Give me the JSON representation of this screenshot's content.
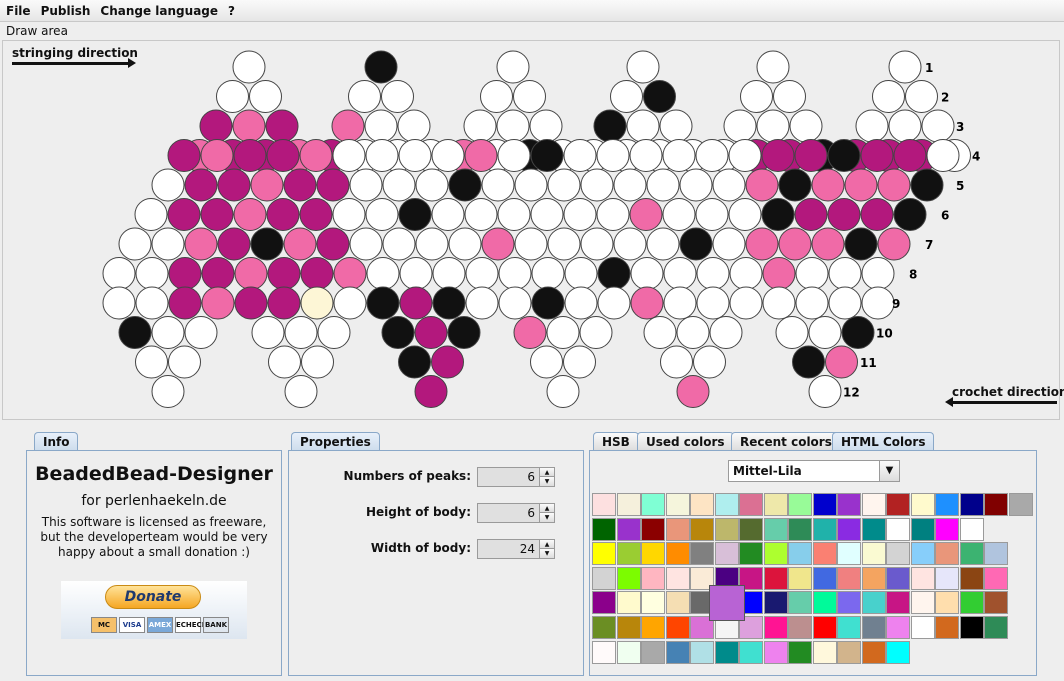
{
  "menu": [
    "File",
    "Publish",
    "Change language",
    "?"
  ],
  "draw_area": {
    "label": "Draw area",
    "stringing_direction": "stringing direction",
    "crochet_direction": "crochet direction",
    "row_numbers": [
      "1",
      "2",
      "3",
      "4",
      "5",
      "6",
      "7",
      "8",
      "9",
      "10",
      "11",
      "12"
    ]
  },
  "info": {
    "tab": "Info",
    "title": "BeadedBead-Designer",
    "subtitle": "for perlenhaekeln.de",
    "text": "This software is licensed as freeware, but the developerteam would be very happy about a small donation :)",
    "donate": "Donate",
    "cards": [
      "MC",
      "VISA",
      "AMEX",
      "ECHECK",
      "BANK"
    ]
  },
  "properties": {
    "tab": "Properties",
    "fields": [
      {
        "label": "Numbers of peaks:",
        "value": "6"
      },
      {
        "label": "Height of body:",
        "value": "6"
      },
      {
        "label": "Width of body:",
        "value": "24"
      }
    ]
  },
  "colors": {
    "tabs": [
      "HSB",
      "Used colors",
      "Recent colors",
      "HTML Colors"
    ],
    "active_tab": "HTML Colors",
    "selected": "Mittel-Lila",
    "selected_color": "#b863d4",
    "swatches": [
      [
        "#fde0e0",
        "#f5f0dc",
        "#7fffd4",
        "#f5f5dc",
        "#fde4c4",
        "#afeeee",
        "#db7093",
        "#eee8aa",
        "#98fb98",
        "#0000cd",
        "#9932cc",
        "#fff5ee",
        "#b22222",
        "#fffacd",
        "#1e90ff",
        "#00008b",
        "#800000",
        "#a9a9a9"
      ],
      [
        "#006400",
        "#9932cc",
        "#8b0000",
        "#e9967a",
        "#b8860b",
        "#bdb76b",
        "#556b2f",
        "#66cdaa",
        "#2e8b57",
        "#20b2aa",
        "#8a2be2",
        "#008b8b",
        "#ffffff",
        "#008080",
        "#ff00ff",
        "#ffffff"
      ],
      [
        "#ffff00",
        "#9acd32",
        "#ffd700",
        "#ff8c00",
        "#808080",
        "#d8bfd8",
        "#228b22",
        "#adff2f",
        "#87ceeb",
        "#fa8072",
        "#e0ffff",
        "#fafad2",
        "#d3d3d3",
        "#87cefa",
        "#e9967a",
        "#3cb371",
        "#b0c4de"
      ],
      [
        "#d3d3d3",
        "#7cfc00",
        "#ffb6c1",
        "#ffe4e1",
        "#faebd7",
        "#4b0082",
        "#c71585",
        "#dc143c",
        "#f0e68c",
        "#4169e1",
        "#f08080",
        "#f4a460",
        "#6a5acd",
        "#ffe4e1",
        "#e6e6fa",
        "#8b4513",
        "#ff69b4"
      ],
      [
        "#8b008b",
        "#fffacd",
        "#ffffe0",
        "#f5deb3",
        "#696969",
        "#b863d4",
        "#0000ff",
        "#191970",
        "#66cdaa",
        "#00fa9a",
        "#7b68ee",
        "#48d1cc",
        "#c71585",
        "#fff5ee",
        "#ffdead",
        "#32cd32",
        "#a0522d"
      ],
      [
        "#6b8e23",
        "#b8860b",
        "#ffa500",
        "#ff4500",
        "#da70d6",
        "#f5f5f5",
        "#dda0dd",
        "#ff1493",
        "#bc8f8f",
        "#ff0000",
        "#40e0d0",
        "#708090",
        "#ee82ee",
        "#ffffff",
        "#d2691e",
        "#000000",
        "#2e8b57"
      ],
      [
        "#fffafa",
        "#f0fff0",
        "#a9a9a9",
        "#4682b4",
        "#b0e0e6",
        "#008b8b",
        "#40e0d0",
        "#ee82ee",
        "#228b22",
        "#fff8dc",
        "#d2b48c",
        "#d2691e",
        "#00ffff"
      ]
    ]
  }
}
